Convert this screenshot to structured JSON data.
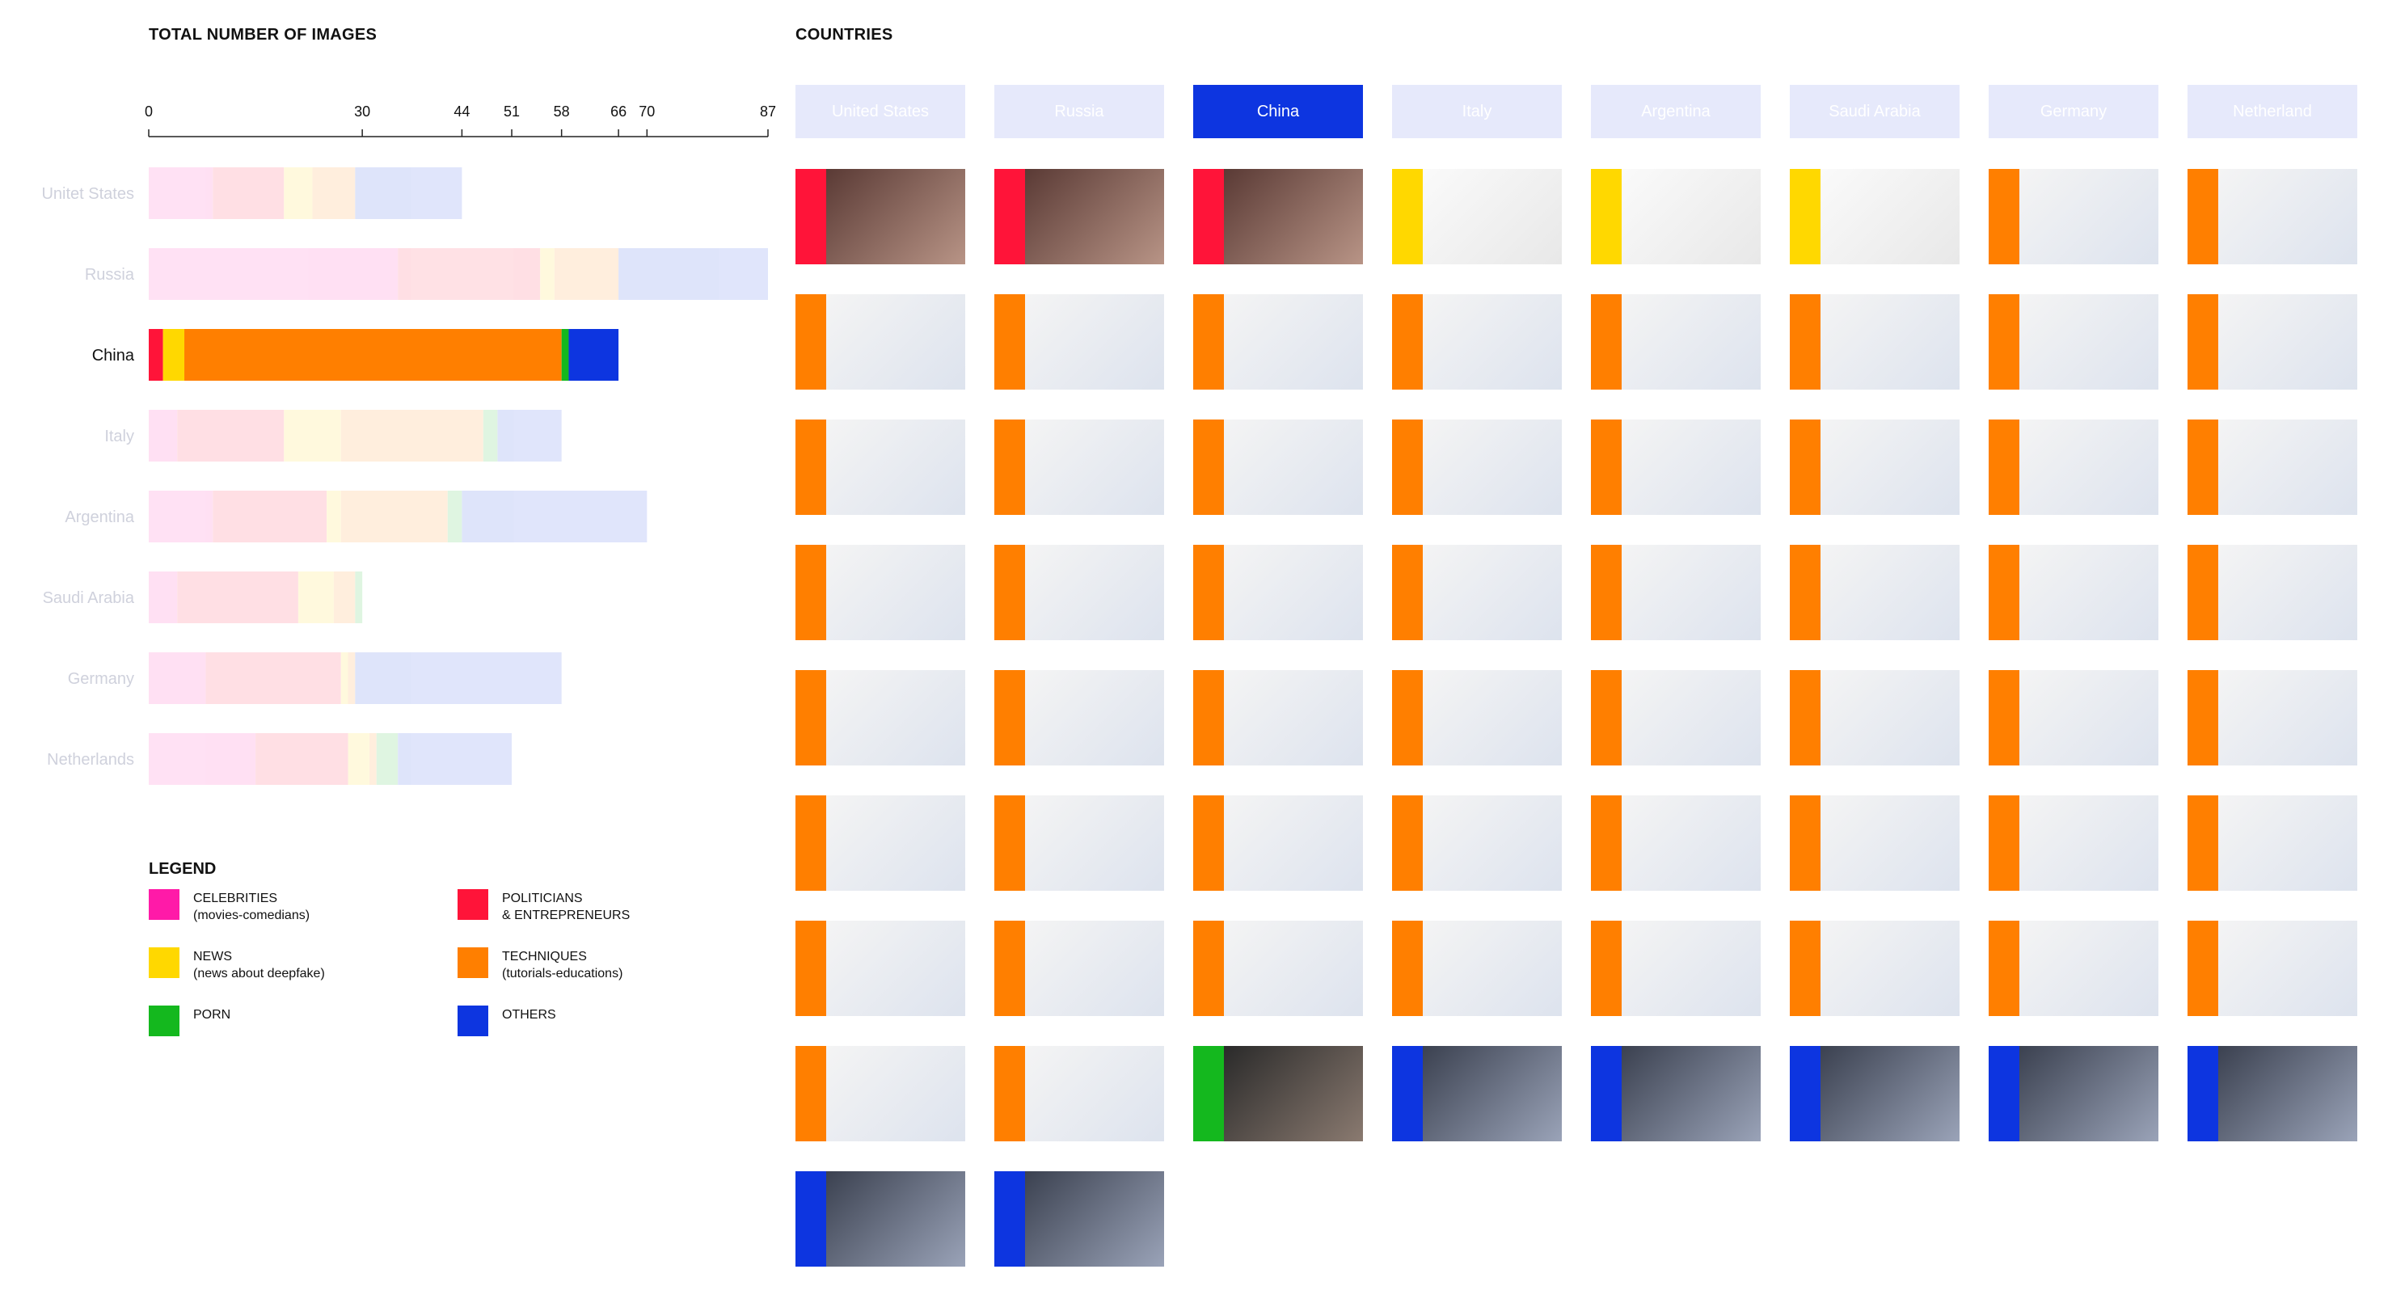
{
  "chart_data": {
    "type": "bar",
    "stacked": true,
    "orientation": "horizontal",
    "title": "TOTAL NUMBER OF IMAGES",
    "xlim": [
      0,
      87
    ],
    "xticks": [
      0,
      30,
      44,
      51,
      58,
      66,
      70,
      87
    ],
    "highlighted": "China",
    "categories": [
      "Unitet States",
      "Russia",
      "China",
      "Italy",
      "Argentina",
      "Saudi Arabia",
      "Germany",
      "Netherlands"
    ],
    "series": [
      {
        "name": "CELEBRITIES (movies-comedians)",
        "color": "#ff1aa8",
        "values": [
          9,
          0,
          0,
          0,
          0,
          0,
          0,
          0
        ]
      },
      {
        "name": "POLITICIANS & ENTREPRENEURS",
        "color": "#ff1439",
        "values": [
          10,
          0,
          0,
          0,
          0,
          0,
          0,
          0
        ]
      },
      {
        "name": "NEWS (news about deepfake)",
        "color": "#ffd800",
        "values": [
          0,
          0,
          0,
          0,
          0,
          0,
          0,
          0
        ]
      },
      {
        "name": "TECHNIQUES (tutorials-educations)",
        "color": "#ff7f00",
        "values": [
          0,
          0,
          0,
          0,
          0,
          0,
          0,
          0
        ]
      },
      {
        "name": "PORN",
        "color": "#14b81e",
        "values": [
          0,
          0,
          0,
          0,
          0,
          0,
          0,
          0
        ]
      },
      {
        "name": "OTHERS",
        "color": "#0d35e0",
        "values": [
          0,
          0,
          0,
          0,
          0,
          0,
          0,
          0
        ]
      }
    ],
    "stack_segments": [
      [
        [
          "CELEBRITIES (movies-comedians)",
          9
        ],
        [
          "POLITICIANS & ENTREPRENEURS",
          10
        ],
        [
          "NEWS (news about deepfake)",
          4
        ],
        [
          "TECHNIQUES (tutorials-educations)",
          6
        ],
        [
          "OTHERS",
          15
        ]
      ],
      [
        [
          "CELEBRITIES (movies-comedians)",
          35
        ],
        [
          "POLITICIANS & ENTREPRENEURS",
          20
        ],
        [
          "NEWS (news about deepfake)",
          2
        ],
        [
          "TECHNIQUES (tutorials-educations)",
          9
        ],
        [
          "OTHERS",
          21
        ]
      ],
      [
        [
          "POLITICIANS & ENTREPRENEURS",
          2
        ],
        [
          "NEWS (news about deepfake)",
          3
        ],
        [
          "TECHNIQUES (tutorials-educations)",
          53
        ],
        [
          "PORN",
          1
        ],
        [
          "OTHERS",
          7
        ]
      ],
      [
        [
          "CELEBRITIES (movies-comedians)",
          4
        ],
        [
          "POLITICIANS & ENTREPRENEURS",
          15
        ],
        [
          "NEWS (news about deepfake)",
          8
        ],
        [
          "TECHNIQUES (tutorials-educations)",
          20
        ],
        [
          "PORN",
          2
        ],
        [
          "OTHERS",
          9
        ]
      ],
      [
        [
          "CELEBRITIES (movies-comedians)",
          9
        ],
        [
          "POLITICIANS & ENTREPRENEURS",
          16
        ],
        [
          "NEWS (news about deepfake)",
          2
        ],
        [
          "TECHNIQUES (tutorials-educations)",
          15
        ],
        [
          "PORN",
          2
        ],
        [
          "OTHERS",
          26
        ]
      ],
      [
        [
          "CELEBRITIES (movies-comedians)",
          4
        ],
        [
          "POLITICIANS & ENTREPRENEURS",
          17
        ],
        [
          "NEWS (news about deepfake)",
          5
        ],
        [
          "TECHNIQUES (tutorials-educations)",
          3
        ],
        [
          "PORN",
          1
        ]
      ],
      [
        [
          "CELEBRITIES (movies-comedians)",
          8
        ],
        [
          "POLITICIANS & ENTREPRENEURS",
          19
        ],
        [
          "NEWS (news about deepfake)",
          1
        ],
        [
          "TECHNIQUES (tutorials-educations)",
          1
        ],
        [
          "OTHERS",
          29
        ]
      ],
      [
        [
          "CELEBRITIES (movies-comedians)",
          15
        ],
        [
          "POLITICIANS & ENTREPRENEURS",
          13
        ],
        [
          "NEWS (news about deepfake)",
          3
        ],
        [
          "TECHNIQUES (tutorials-educations)",
          1
        ],
        [
          "PORN",
          3
        ],
        [
          "OTHERS",
          16
        ]
      ]
    ]
  },
  "countries_section": {
    "title": "COUNTRIES",
    "selected": "China",
    "headers": [
      "United States",
      "Russia",
      "China",
      "Italy",
      "Argentina",
      "Saudi Arabia",
      "Germany",
      "Netherland"
    ],
    "columns": [
      [
        "politicians",
        "techniques",
        "techniques",
        "techniques",
        "techniques",
        "techniques",
        "techniques",
        "techniques",
        "others"
      ],
      [
        "politicians",
        "techniques",
        "techniques",
        "techniques",
        "techniques",
        "techniques",
        "techniques",
        "techniques",
        "others"
      ],
      [
        "politicians",
        "techniques",
        "techniques",
        "techniques",
        "techniques",
        "techniques",
        "techniques",
        "porn"
      ],
      [
        "news",
        "techniques",
        "techniques",
        "techniques",
        "techniques",
        "techniques",
        "techniques",
        "others"
      ],
      [
        "news",
        "techniques",
        "techniques",
        "techniques",
        "techniques",
        "techniques",
        "techniques",
        "others"
      ],
      [
        "news",
        "techniques",
        "techniques",
        "techniques",
        "techniques",
        "techniques",
        "techniques",
        "others"
      ],
      [
        "techniques",
        "techniques",
        "techniques",
        "techniques",
        "techniques",
        "techniques",
        "techniques",
        "others"
      ],
      [
        "techniques",
        "techniques",
        "techniques",
        "techniques",
        "techniques",
        "techniques",
        "techniques",
        "others"
      ]
    ]
  },
  "legend": {
    "title": "LEGEND",
    "items": [
      {
        "line1": "CELEBRITIES",
        "line2": "(movies-comedians)",
        "color": "#ff1aa8"
      },
      {
        "line1": "POLITICIANS",
        "line2": "& ENTREPRENEURS",
        "color": "#ff1439"
      },
      {
        "line1": "NEWS",
        "line2": "(news about deepfake)",
        "color": "#ffd800"
      },
      {
        "line1": "TECHNIQUES",
        "line2": "(tutorials-educations)",
        "color": "#ff7f00"
      },
      {
        "line1": "PORN",
        "line2": "",
        "color": "#14b81e"
      },
      {
        "line1": "OTHERS",
        "line2": "",
        "color": "#0d35e0"
      }
    ]
  },
  "category_colors": {
    "politicians": "#ff1439",
    "news": "#ffd800",
    "techniques": "#ff7f00",
    "porn": "#14b81e",
    "others": "#0d35e0"
  },
  "header_colors": {
    "selected": "#0d35e0",
    "unselected": "#e6e9fb",
    "selected_text": "#ffffff"
  }
}
